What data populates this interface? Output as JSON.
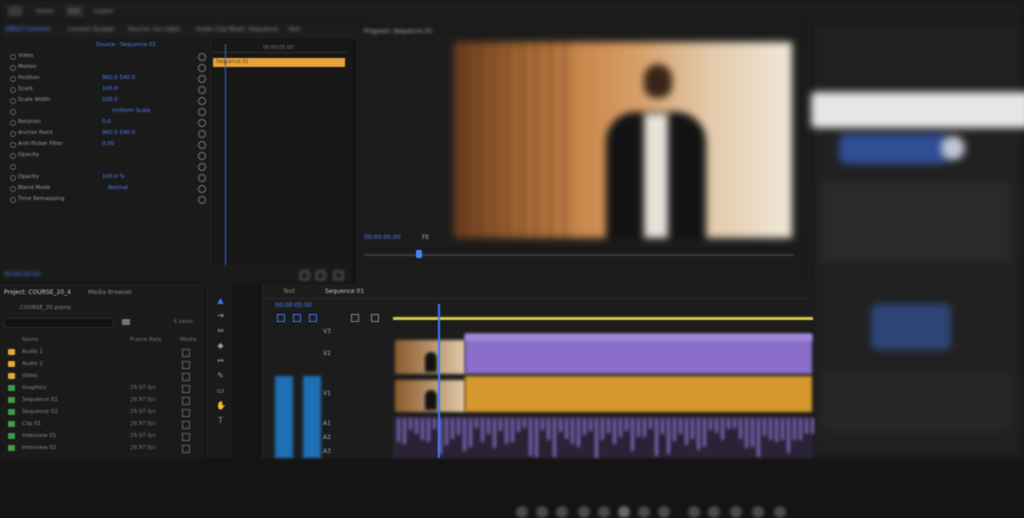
{
  "menubar": {
    "items": [
      "Home",
      "Edit",
      "Export"
    ]
  },
  "tabs": [
    {
      "label": "Effect Controls",
      "active": true
    },
    {
      "label": "Lumetri Scopes",
      "active": false
    },
    {
      "label": "Source: (no clips)",
      "active": false
    },
    {
      "label": "Audio Clip Mixer: Sequence",
      "active": false
    },
    {
      "label": "Text",
      "active": false
    }
  ],
  "effect_controls": {
    "source_label": "Source · Sequence 01",
    "clip_bar": "Sequence 01",
    "mini_time": "00:00:05:00",
    "rows": [
      {
        "label": "Video",
        "value": ""
      },
      {
        "label": "Motion",
        "value": ""
      },
      {
        "label": "Position",
        "value": "960.0   540.0"
      },
      {
        "label": "Scale",
        "value": "100.0"
      },
      {
        "label": "Scale Width",
        "value": "100.0"
      },
      {
        "label": "",
        "value": "Uniform Scale"
      },
      {
        "label": "Rotation",
        "value": "0.0"
      },
      {
        "label": "Anchor Point",
        "value": "960.0   540.0"
      },
      {
        "label": "Anti-flicker Filter",
        "value": "0.00"
      },
      {
        "label": "Opacity",
        "value": ""
      },
      {
        "label": "",
        "value": ""
      },
      {
        "label": "Opacity",
        "value": "100.0 %"
      },
      {
        "label": "Blend Mode",
        "value": "Normal"
      },
      {
        "label": "Time Remapping",
        "value": ""
      }
    ],
    "footer_time": "00:00:00:00"
  },
  "program": {
    "title": "Program: Sequence 01",
    "timecode": "00:00:00:00",
    "fit": "Fit"
  },
  "project": {
    "tabs": [
      "Project: COURSE_20_4",
      "Media Browser"
    ],
    "file": "COURSE_20.prproj",
    "count": "6 items",
    "columns": [
      "Name",
      "Frame Rate",
      "Media"
    ],
    "items": [
      {
        "name": "Audio 1",
        "rate": "",
        "color": "#e3a93a"
      },
      {
        "name": "Audio 2",
        "rate": "",
        "color": "#e3a93a"
      },
      {
        "name": "Video",
        "rate": "",
        "color": "#e3a93a"
      },
      {
        "name": "Graphics",
        "rate": "29.97 fps",
        "color": "#3f9a4a"
      },
      {
        "name": "Sequence 01",
        "rate": "29.97 fps",
        "color": "#3f9a4a"
      },
      {
        "name": "Sequence 02",
        "rate": "29.97 fps",
        "color": "#3f9a4a"
      },
      {
        "name": "Clip 01",
        "rate": "29.97 fps",
        "color": "#3f9a4a"
      },
      {
        "name": "Interview 01",
        "rate": "29.97 fps",
        "color": "#3f9a4a"
      },
      {
        "name": "Interview 02",
        "rate": "29.97 fps",
        "color": "#3f9a4a"
      }
    ]
  },
  "tools": [
    "selection-tool",
    "track-select-tool",
    "ripple-edit-tool",
    "razor-tool",
    "slip-tool",
    "pen-tool",
    "rectangle-tool",
    "hand-tool",
    "type-tool"
  ],
  "timeline": {
    "tabs": [
      "Text",
      "Sequence 01"
    ],
    "timecode": "00:00:05:00",
    "tracks": [
      "V3",
      "V2",
      "V1",
      "A1",
      "A2",
      "A3"
    ]
  }
}
